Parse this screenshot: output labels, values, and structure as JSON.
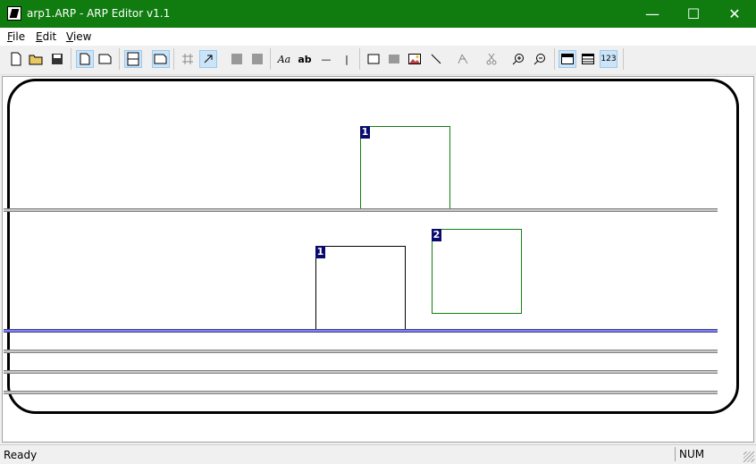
{
  "window": {
    "title": "arp1.ARP - ARP Editor v1.1",
    "buttons": {
      "minimize": "—",
      "maximize": "☐",
      "close": "✕"
    }
  },
  "menu": [
    {
      "label": "File",
      "accel": "F",
      "rest": "ile"
    },
    {
      "label": "Edit",
      "accel": "E",
      "rest": "dit"
    },
    {
      "label": "View",
      "accel": "V",
      "rest": "iew"
    }
  ],
  "toolbar": {
    "new_icon": "new-icon",
    "open_icon": "open-icon",
    "save_icon": "save-icon",
    "font_label": "Aa",
    "text_label": "ab",
    "hline_label": "—",
    "vline_label": "|",
    "numbers_label": "123"
  },
  "canvas": {
    "fields": [
      {
        "tag": "1",
        "style": "green"
      },
      {
        "tag": "1",
        "style": "black"
      },
      {
        "tag": "2",
        "style": "green"
      }
    ]
  },
  "status": {
    "text": "Ready",
    "num": "NUM"
  },
  "colors": {
    "titlebar": "#107c10",
    "field_tag": "#0a0a6e",
    "selected_band": "#8080ff"
  }
}
